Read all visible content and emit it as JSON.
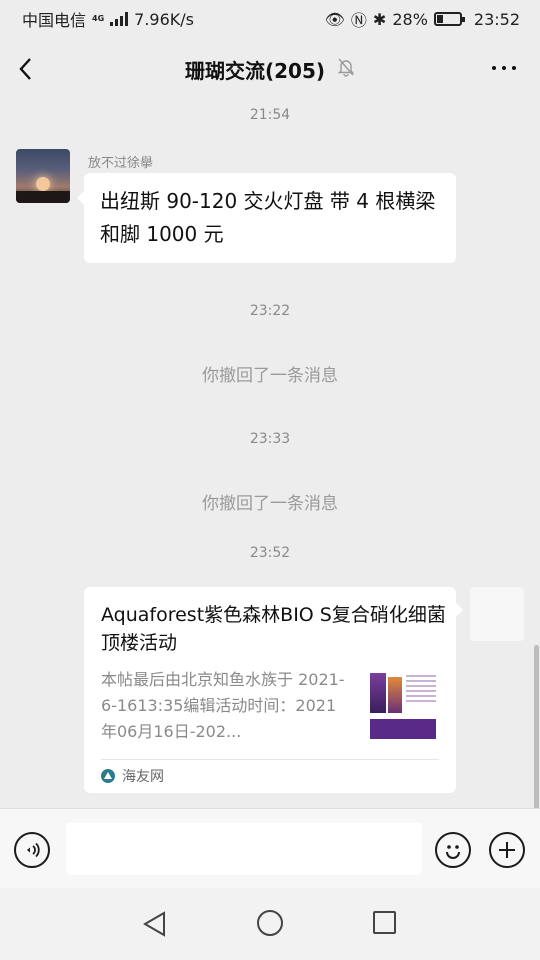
{
  "status_bar": {
    "carrier": "中国电信",
    "network": "4G",
    "speed": "7.96K/s",
    "battery": "28%",
    "time": "23:52"
  },
  "header": {
    "title": "珊瑚交流(205)"
  },
  "messages": {
    "time1": "21:54",
    "sender_name": "放不过徐擧",
    "text1": "出纽斯 90-120 交火灯盘  带 4 根横梁和脚  1000 元",
    "time2": "23:22",
    "recall1": "你撤回了一条消息",
    "time3": "23:33",
    "recall2": "你撤回了一条消息",
    "time4": "23:52"
  },
  "link_card": {
    "title": "Aquaforest紫色森林BIO S复合硝化细菌顶楼活动",
    "description": "本帖最后由北京知鱼水族于 2021-6-1613:35编辑活动时间：2021年06月16日-202...",
    "source": "海友网"
  },
  "input": {
    "value": ""
  },
  "icons": {
    "back": "chevron-left-icon",
    "mute": "bell-off-icon",
    "more": "more-dots-icon",
    "voice": "voice-icon",
    "emoji": "emoji-icon",
    "plus": "plus-icon",
    "nav_back": "nav-back-icon",
    "nav_home": "nav-home-icon",
    "nav_recent": "nav-recent-icon"
  }
}
